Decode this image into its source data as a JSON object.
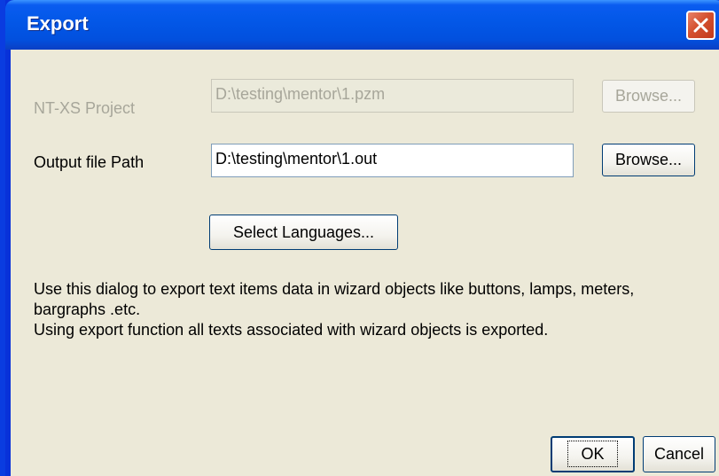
{
  "window": {
    "title": "Export"
  },
  "project": {
    "label": "NT-XS Project",
    "value": "D:\\testing\\mentor\\1.pzm",
    "browse_label": "Browse..."
  },
  "output": {
    "label": "Output file Path",
    "value": "D:\\testing\\mentor\\1.out",
    "browse_label": "Browse..."
  },
  "select_languages_label": "Select Languages...",
  "description": {
    "line1": "Use this dialog to export text items data in wizard objects like buttons, lamps, meters, bargraphs .etc.",
    "line2": "Using export function all texts associated with wizard objects is exported."
  },
  "buttons": {
    "ok_label": "OK",
    "cancel_label": "Cancel"
  },
  "colors": {
    "titlebar": "#0358e8",
    "dialog_bg": "#ece9d8",
    "close_button": "#d4502f",
    "disabled_text": "#a7a69a"
  },
  "icons": {
    "close": "close-icon"
  }
}
